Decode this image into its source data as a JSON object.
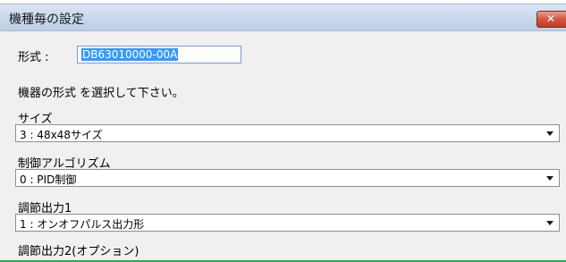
{
  "window": {
    "title": "機種毎の設定",
    "close_icon": "close-icon",
    "close_color": "#d2573e"
  },
  "format": {
    "label": "形式 :",
    "value": "DB63010000-00A"
  },
  "instruction": "機器の形式 を選択して下さい。",
  "fields": [
    {
      "label": "サイズ",
      "value": "3 : 48x48サイズ"
    },
    {
      "label": "制御アルゴリズム",
      "value": "0 : PID制御"
    },
    {
      "label": "調節出力1",
      "value": "1 : オンオフパルス出力形"
    },
    {
      "label": "調節出力2(オプション)",
      "value": ""
    }
  ],
  "accent_colors": {
    "selection": "#3399ff",
    "status_line": "#25b04a"
  }
}
